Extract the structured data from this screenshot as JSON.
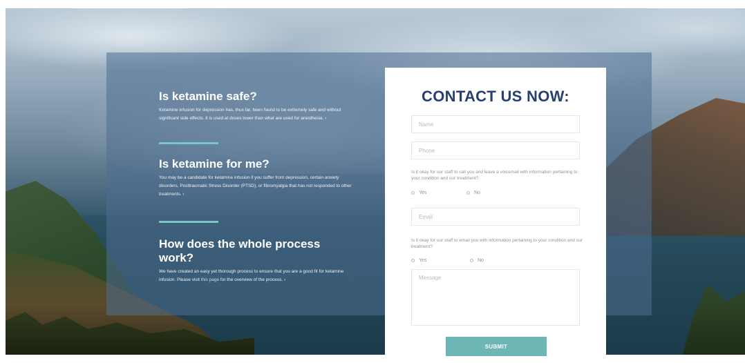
{
  "faq": [
    {
      "heading": "Is ketamine safe?",
      "body": "Ketamine infusion for depression has, thus far, been found to be extremely safe and without significant side effects. It is used at doses lower than what are used for anesthesia.",
      "more": "›"
    },
    {
      "heading": "Is ketamine for me?",
      "body": "You may be a candidate for ketamine infusion if you suffer from depression, certain anxiety disorders, Posttraumatic Stress Disorder (PTSD), or fibromyalgia that has not responded to other treatments.",
      "more": "›"
    },
    {
      "heading": "How does the whole process work?",
      "body_pre": "We have created an easy yet thorough process to ensure that you are a good fit for ketamine infusion. Please visit ",
      "link_text": "this page",
      "body_post": " for the overview of the process.",
      "more": "›"
    }
  ],
  "contact": {
    "title": "CONTACT US NOW:",
    "name_placeholder": "Name",
    "phone_placeholder": "Phone",
    "voicemail_question": "Is it okay for our staff to call you and leave a voicemail with information pertaining to your condition and our treatment?",
    "email_placeholder": "Email",
    "email_question": "Is it okay for our staff to email you with information pertaining to your condition and our treatment?",
    "yes_label": "Yes",
    "no_label": "No",
    "message_placeholder": "Message",
    "submit_label": "SUBMIT"
  },
  "colors": {
    "title": "#27406e",
    "accent": "#6db6b5",
    "divider": "#7cc6c8"
  }
}
